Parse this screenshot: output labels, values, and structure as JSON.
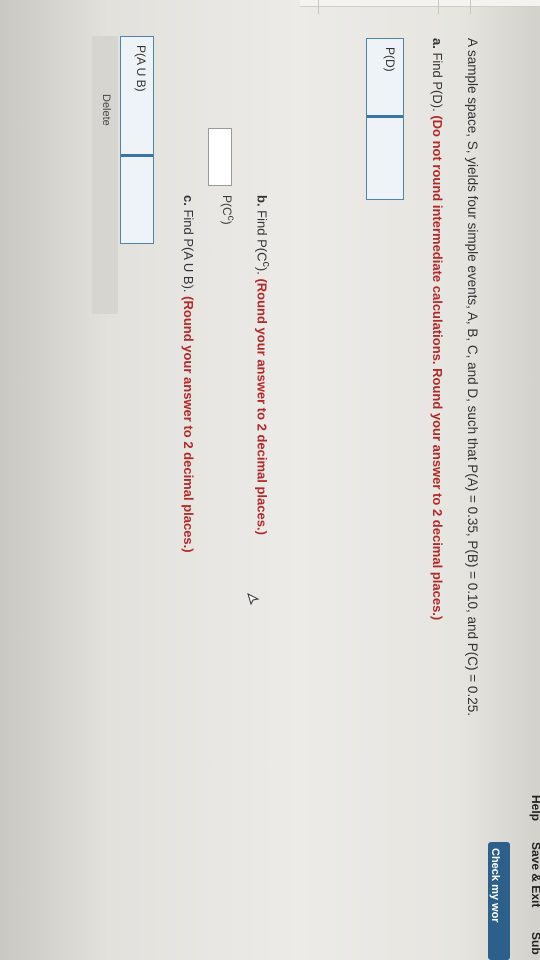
{
  "header": {
    "help_label": "Help",
    "save_exit_label": "Save & Exit",
    "submit_label": "Sub",
    "check_label": "Check my wor"
  },
  "question": {
    "intro": "A sample space, S, yields four simple events, A, B, C, and D, such that P(A) = 0.35, P(B) = 0.10, and P(C) = 0.25.",
    "part_a": {
      "prefix": "a.",
      "lead": " Find P(D). ",
      "instruction": "(Do not round intermediate calculations. Round your answer to 2 decimal places.)",
      "field_label": "P(D)",
      "value": ""
    },
    "part_b": {
      "prefix": "b.",
      "lead": " Find P(C",
      "sup": "c",
      "tail": "). ",
      "instruction": "(Round your answer to 2 decimal places.)",
      "field_label": "P(C",
      "field_sup": "c",
      "field_tail": ")",
      "value": ""
    },
    "part_c": {
      "prefix": "c.",
      "lead": " Find P(A U B). ",
      "instruction": "(Round your answer to 2 decimal places.)",
      "field_label": "P(A U B)",
      "value": ""
    }
  },
  "footer": {
    "delete_label": "Delete"
  }
}
